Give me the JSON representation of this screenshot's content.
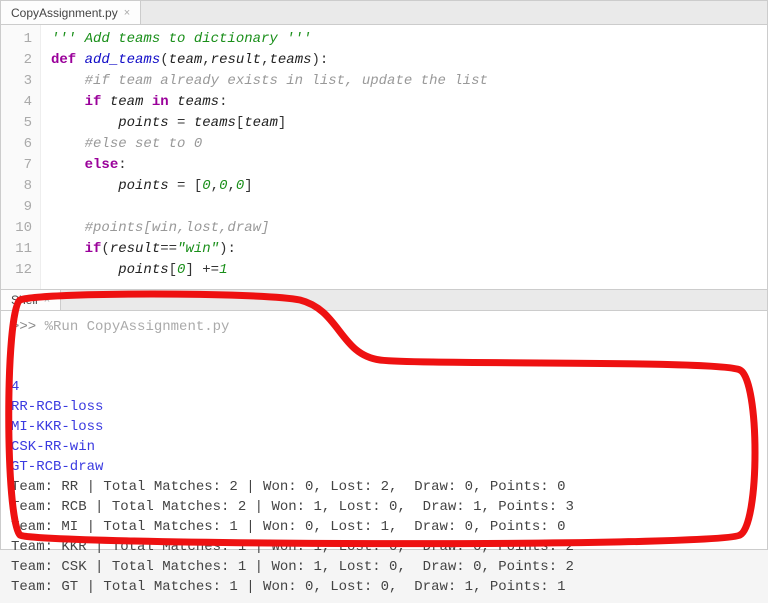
{
  "editor": {
    "tab_label": "CopyAssignment.py",
    "lines": [
      {
        "n": 1,
        "html": "<span class='tok-str'>''' Add teams to dictionary '''</span>"
      },
      {
        "n": 2,
        "html": "<span class='tok-def'>def</span> <span class='tok-fn'>add_teams</span><span class='tok-op'>(</span><span class='tok-id'>team</span><span class='tok-op'>,</span><span class='tok-id'>result</span><span class='tok-op'>,</span><span class='tok-id'>teams</span><span class='tok-op'>):</span>"
      },
      {
        "n": 3,
        "html": "    <span class='tok-cmt'>#if team already exists in list, update the list</span>"
      },
      {
        "n": 4,
        "html": "    <span class='tok-kw'>if</span> <span class='tok-id'>team</span> <span class='tok-kw'>in</span> <span class='tok-id'>teams</span><span class='tok-op'>:</span>"
      },
      {
        "n": 5,
        "html": "        <span class='tok-id'>points</span> <span class='tok-op'>=</span> <span class='tok-id'>teams</span><span class='tok-op'>[</span><span class='tok-id'>team</span><span class='tok-op'>]</span>"
      },
      {
        "n": 6,
        "html": "    <span class='tok-cmt'>#else set to 0</span>"
      },
      {
        "n": 7,
        "html": "    <span class='tok-kw'>else</span><span class='tok-op'>:</span>"
      },
      {
        "n": 8,
        "html": "        <span class='tok-id'>points</span> <span class='tok-op'>=</span> <span class='tok-op'>[</span><span class='tok-num'>0</span><span class='tok-op'>,</span><span class='tok-num'>0</span><span class='tok-op'>,</span><span class='tok-num'>0</span><span class='tok-op'>]</span>"
      },
      {
        "n": 9,
        "html": ""
      },
      {
        "n": 10,
        "html": "    <span class='tok-cmt'>#points[win,lost,draw]</span>"
      },
      {
        "n": 11,
        "html": "    <span class='tok-kw'>if</span><span class='tok-op'>(</span><span class='tok-id'>result</span><span class='tok-op'>==</span><span class='tok-str'>\"win\"</span><span class='tok-op'>):</span>"
      },
      {
        "n": 12,
        "html": "        <span class='tok-id'>points</span><span class='tok-op'>[</span><span class='tok-num'>0</span><span class='tok-op'>]</span> <span class='tok-op'>+=</span><span class='tok-num'>1</span>"
      }
    ]
  },
  "shell": {
    "tab_label": "Shell",
    "prompt": ">>>",
    "command": "%Run CopyAssignment.py",
    "stdin": [
      "4",
      "RR-RCB-loss",
      "MI-KKR-loss",
      "CSK-RR-win",
      "GT-RCB-draw"
    ],
    "stdout": [
      "Team: RR | Total Matches: 2 | Won: 0, Lost: 2,  Draw: 0, Points: 0",
      "Team: RCB | Total Matches: 2 | Won: 1, Lost: 0,  Draw: 1, Points: 3",
      "Team: MI | Total Matches: 1 | Won: 0, Lost: 1,  Draw: 0, Points: 0",
      "Team: KKR | Total Matches: 1 | Won: 1, Lost: 0,  Draw: 0, Points: 2",
      "Team: CSK | Total Matches: 1 | Won: 1, Lost: 0,  Draw: 0, Points: 2",
      "Team: GT | Total Matches: 1 | Won: 0, Lost: 0,  Draw: 1, Points: 1"
    ]
  }
}
